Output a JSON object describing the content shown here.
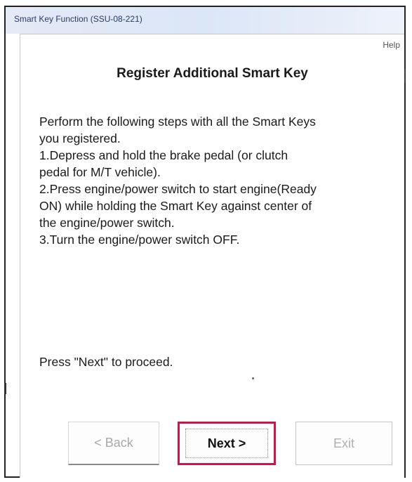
{
  "window": {
    "title": "Smart Key Function (SSU-08-221)"
  },
  "header": {
    "help_label": "Help",
    "heading": "Register Additional Smart Key"
  },
  "instructions": {
    "lines": [
      "Perform the following steps with all the Smart Keys",
      "you registered.",
      "1.Depress and hold the brake pedal (or clutch",
      "pedal for M/T vehicle).",
      "2.Press engine/power switch to start engine(Ready",
      "ON) while holding the Smart Key against center of",
      "the engine/power switch.",
      "3.Turn the engine/power switch OFF."
    ],
    "proceed": "Press \"Next\" to proceed."
  },
  "buttons": {
    "back_label": "< Back",
    "back_enabled": false,
    "next_label": "Next >",
    "next_enabled": true,
    "next_focus_color": "#c8184b",
    "exit_label": "Exit",
    "exit_enabled": false
  }
}
